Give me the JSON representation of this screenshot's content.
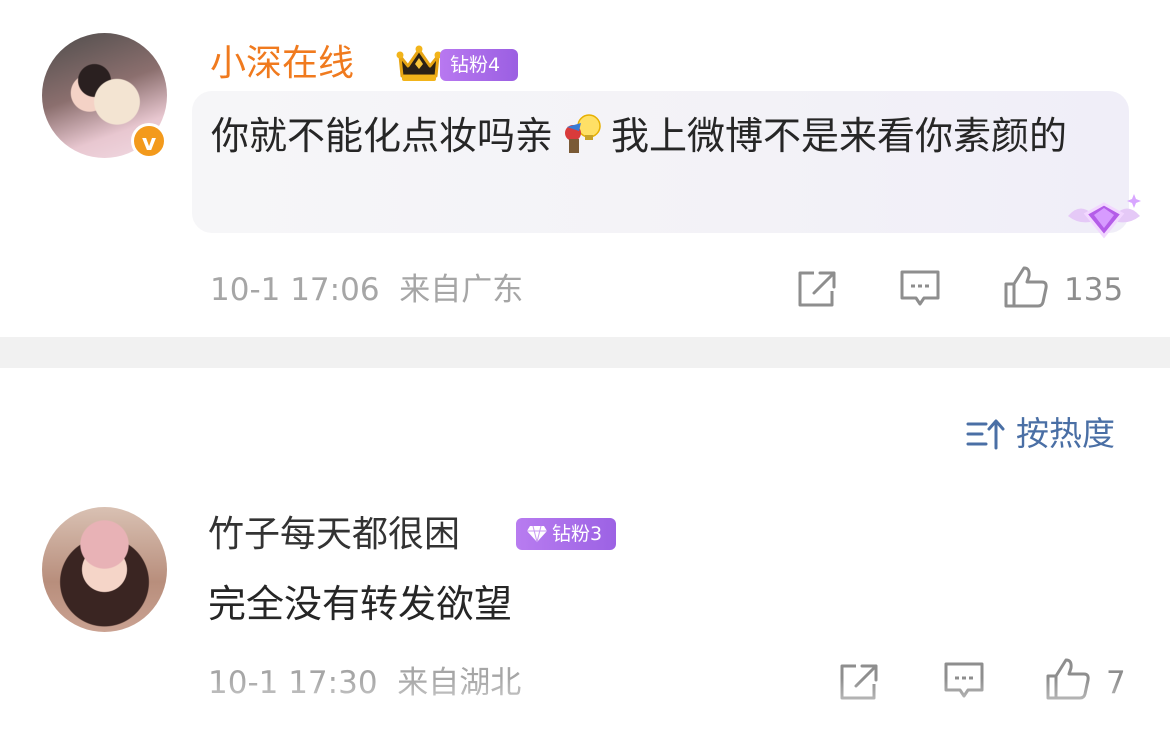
{
  "comments": [
    {
      "username": "小深在线",
      "fan_badge": "钻粉4",
      "verified_mark": "v",
      "text_part1": "你就不能化点妆吗亲",
      "text_part2": "我上微博不是来看你素颜的",
      "emoji": "thinking-bulb-emoji",
      "time": "10-1 17:06",
      "location": "来自广东",
      "likes": "135",
      "bubble_badge": "diamond-wing-badge"
    },
    {
      "username": "竹子每天都很困",
      "fan_badge": "钻粉3",
      "text": "完全没有转发欲望",
      "time": "10-1 17:30",
      "location": "来自湖北",
      "likes": "7"
    }
  ],
  "sort": {
    "label": "按热度",
    "icon": "sort-icon"
  },
  "colors": {
    "username_accent": "#f07a1e",
    "fan_badge": "#a56ae6",
    "meta_text": "#a6a6a6",
    "sort_link": "#4a6fa5",
    "divider": "#f1f1f1"
  }
}
